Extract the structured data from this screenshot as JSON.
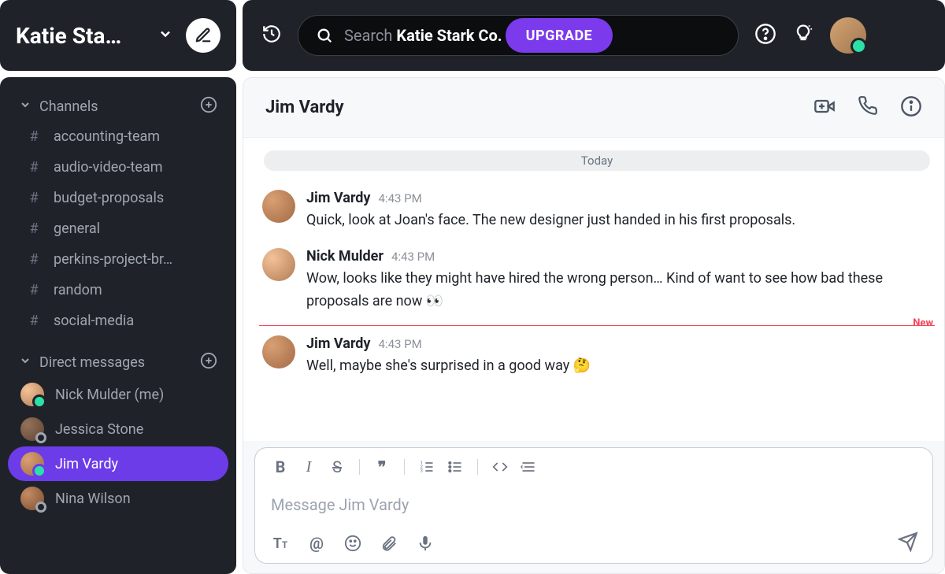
{
  "workspace": {
    "name": "Katie Sta…"
  },
  "header": {
    "search_prefix": "Search",
    "search_ws": "Katie Stark Co.",
    "upgrade": "UPGRADE"
  },
  "sections": {
    "channels_label": "Channels",
    "dms_label": "Direct messages"
  },
  "channels": [
    {
      "name": "accounting-team"
    },
    {
      "name": "audio-video-team"
    },
    {
      "name": "budget-proposals"
    },
    {
      "name": "general"
    },
    {
      "name": "perkins-project-br…"
    },
    {
      "name": "random"
    },
    {
      "name": "social-media"
    }
  ],
  "dms": [
    {
      "name": "Nick Mulder (me)",
      "status": "online",
      "avatar": "av-c1"
    },
    {
      "name": "Jessica Stone",
      "status": "away",
      "avatar": "av-c2"
    },
    {
      "name": "Jim Vardy",
      "status": "online",
      "avatar": "av-c3",
      "active": true
    },
    {
      "name": "Nina Wilson",
      "status": "away",
      "avatar": "av-c4"
    }
  ],
  "conversation": {
    "title": "Jim Vardy",
    "day": "Today",
    "new_label": "New",
    "composer_placeholder": "Message Jim Vardy"
  },
  "messages": [
    {
      "author": "Jim Vardy",
      "time": "4:43 PM",
      "text": "Quick, look at Joan's face. The new designer just handed in his first proposals.",
      "avatar": "av-c3"
    },
    {
      "author": "Nick Mulder",
      "time": "4:43 PM",
      "text": "Wow, looks like they might have hired the wrong person… Kind of want to see how bad these proposals are now 👀",
      "avatar": "av-c1"
    },
    {
      "author": "Jim Vardy",
      "time": "4:43 PM",
      "text": "Well, maybe she's surprised in a good way 🤔",
      "avatar": "av-c3",
      "after_new": true
    }
  ]
}
